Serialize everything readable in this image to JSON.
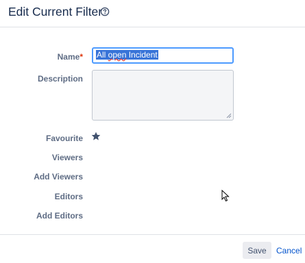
{
  "dialog": {
    "title": "Edit Current Filter",
    "help_icon": "help-circle-icon"
  },
  "form": {
    "name_label": "Name",
    "required_marker": "*",
    "name_value_plain": "All ",
    "name_value_misspelled": "open",
    "name_value_rest": " Incident",
    "description_label": "Description",
    "description_value": "",
    "favourite_label": "Favourite",
    "favourite_icon": "star-filled-icon",
    "viewers_label": "Viewers",
    "add_viewers_label": "Add Viewers",
    "editors_label": "Editors",
    "add_editors_label": "Add Editors"
  },
  "footer": {
    "save_label": "Save",
    "cancel_label": "Cancel"
  },
  "colors": {
    "accent": "#0052cc",
    "focus_border": "#4c9aff",
    "selection": "#3874d8",
    "required": "#de350b",
    "star": "#42526e"
  }
}
